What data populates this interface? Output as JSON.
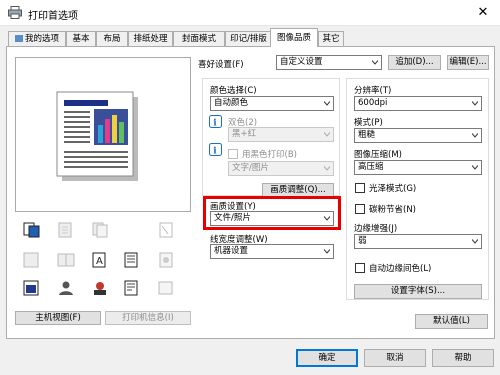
{
  "window": {
    "title": "打印首选项",
    "close_glyph": "✕"
  },
  "tabs": [
    {
      "label": "我的选项"
    },
    {
      "label": "基本"
    },
    {
      "label": "布局"
    },
    {
      "label": "排纸处理"
    },
    {
      "label": "封面模式"
    },
    {
      "label": "印记/排版"
    },
    {
      "label": "图像品质"
    },
    {
      "label": "其它"
    }
  ],
  "preview": {
    "main_view_label": "主机视图(F)",
    "printer_info_label": "打印机信息(I)"
  },
  "favorite": {
    "label": "喜好设置(F)",
    "value": "自定义设置",
    "add_label": "追加(D)...",
    "edit_label": "编辑(E)..."
  },
  "color": {
    "label": "颜色选择(C)",
    "value": "自动颜色"
  },
  "dual_color": {
    "label": "双色(2)",
    "value": "黑+红"
  },
  "black_print": {
    "label": "用黑色打印(B)",
    "value": "文字/图片"
  },
  "quality_adjust_label": "画质调整(Q)...",
  "quality_setting": {
    "label": "画质设置(Y)",
    "value": "文件/照片"
  },
  "line_width": {
    "label": "线宽度调整(W)",
    "value": "机器设置"
  },
  "resolution": {
    "label": "分辨率(T)",
    "value": "600dpi"
  },
  "pattern": {
    "label": "模式(P)",
    "value": "粗糙"
  },
  "image_compression": {
    "label": "图像压缩(M)",
    "value": "高压缩"
  },
  "glossy": {
    "label": "光泽模式(G)",
    "checked": false
  },
  "toner_save": {
    "label": "碳粉节省(N)",
    "checked": false
  },
  "edge_enhance": {
    "label": "边缘增强(J)",
    "value": "弱"
  },
  "auto_trap": {
    "label": "自动边缘间色(L)",
    "checked": false
  },
  "font_settings_label": "设置字体(S)...",
  "default_label": "默认值(L)",
  "footer": {
    "ok_label": "确定",
    "cancel_label": "取消",
    "help_label": "帮助"
  },
  "colors": {
    "highlight_border": "#e60000",
    "info_icon": "#1a6fc4",
    "focus": "#0078d7"
  }
}
